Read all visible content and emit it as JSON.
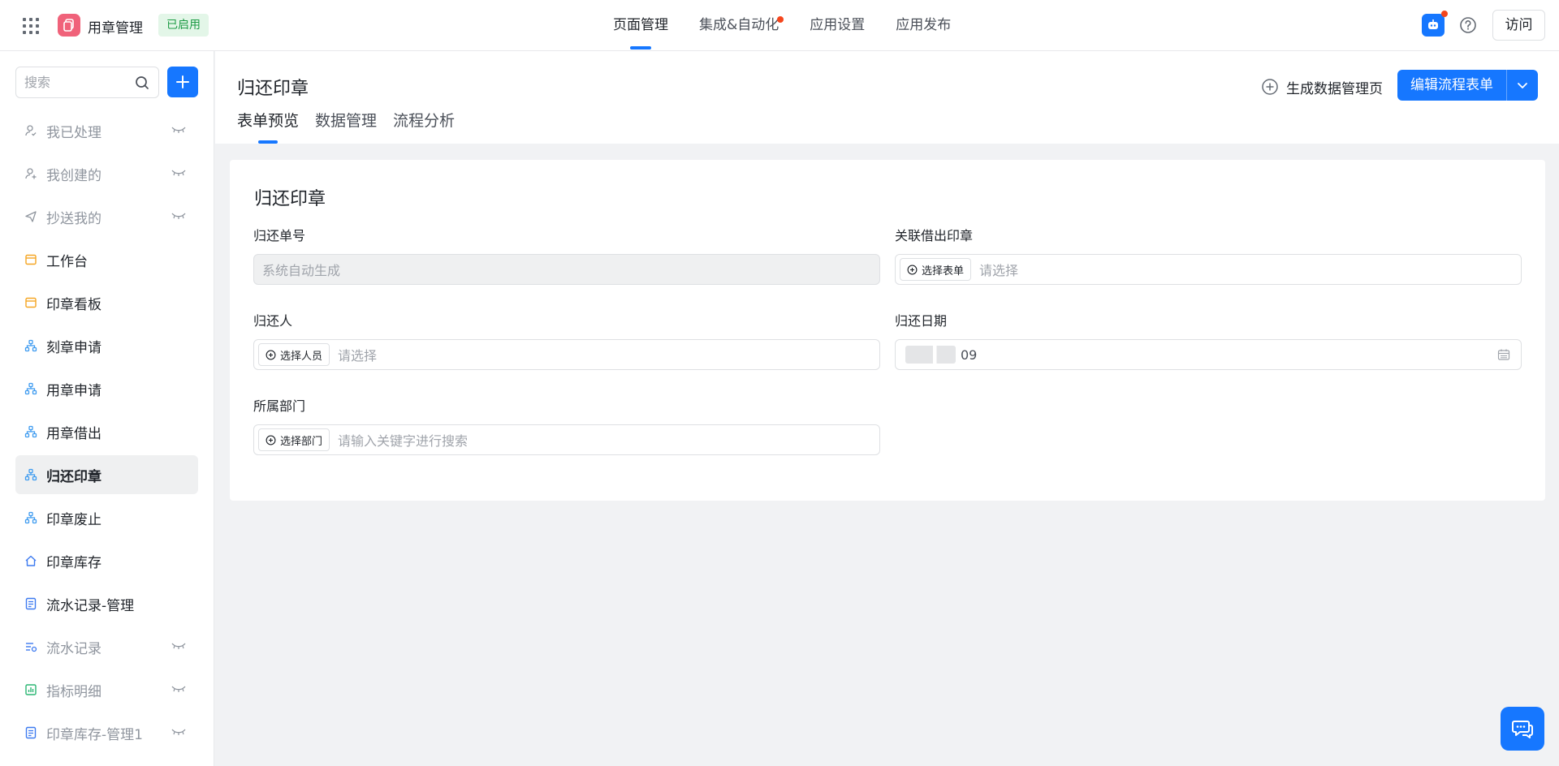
{
  "app": {
    "name": "用章管理",
    "status": "已启用"
  },
  "topnav": [
    {
      "label": "页面管理",
      "active": true
    },
    {
      "label": "集成&自动化",
      "dot": true
    },
    {
      "label": "应用设置"
    },
    {
      "label": "应用发布"
    }
  ],
  "header_right": {
    "visit_label": "访问"
  },
  "sidebar": {
    "search_placeholder": "搜索",
    "items": [
      {
        "label": "我已处理",
        "icon": "user-check-icon",
        "hidden": true
      },
      {
        "label": "我创建的",
        "icon": "user-plus-icon",
        "hidden": true
      },
      {
        "label": "抄送我的",
        "icon": "send-icon",
        "hidden": true
      },
      {
        "label": "工作台",
        "icon": "dashboard-icon"
      },
      {
        "label": "印章看板",
        "icon": "dashboard-icon"
      },
      {
        "label": "刻章申请",
        "icon": "flow-icon"
      },
      {
        "label": "用章申请",
        "icon": "flow-icon"
      },
      {
        "label": "用章借出",
        "icon": "flow-icon"
      },
      {
        "label": "归还印章",
        "icon": "flow-icon",
        "active": true
      },
      {
        "label": "印章废止",
        "icon": "flow-icon"
      },
      {
        "label": "印章库存",
        "icon": "home-icon"
      },
      {
        "label": "流水记录-管理",
        "icon": "report-icon"
      },
      {
        "label": "流水记录",
        "icon": "list-icon",
        "hidden": true
      },
      {
        "label": "指标明细",
        "icon": "chart-icon",
        "hidden": true
      },
      {
        "label": "印章库存-管理1",
        "icon": "report-icon",
        "hidden": true
      }
    ]
  },
  "page": {
    "title": "归还印章",
    "generate_label": "生成数据管理页",
    "edit_label": "编辑流程表单",
    "tabs": [
      {
        "label": "表单预览",
        "active": true
      },
      {
        "label": "数据管理"
      },
      {
        "label": "流程分析"
      }
    ]
  },
  "form": {
    "title": "归还印章",
    "fields": {
      "return_no": {
        "label": "归还单号",
        "placeholder": "系统自动生成"
      },
      "linked_borrow": {
        "label": "关联借出印章",
        "chip": "选择表单",
        "placeholder": "请选择"
      },
      "returner": {
        "label": "归还人",
        "chip": "选择人员",
        "placeholder": "请选择"
      },
      "return_date": {
        "label": "归还日期",
        "value": "09"
      },
      "department": {
        "label": "所属部门",
        "chip": "选择部门",
        "placeholder": "请输入关键字进行搜索"
      }
    }
  },
  "colors": {
    "primary": "#1677ff",
    "logo": "#f0627a",
    "badge_bg": "#e3f6e8",
    "badge_text": "#1d9b45",
    "dot": "#f5461d"
  }
}
